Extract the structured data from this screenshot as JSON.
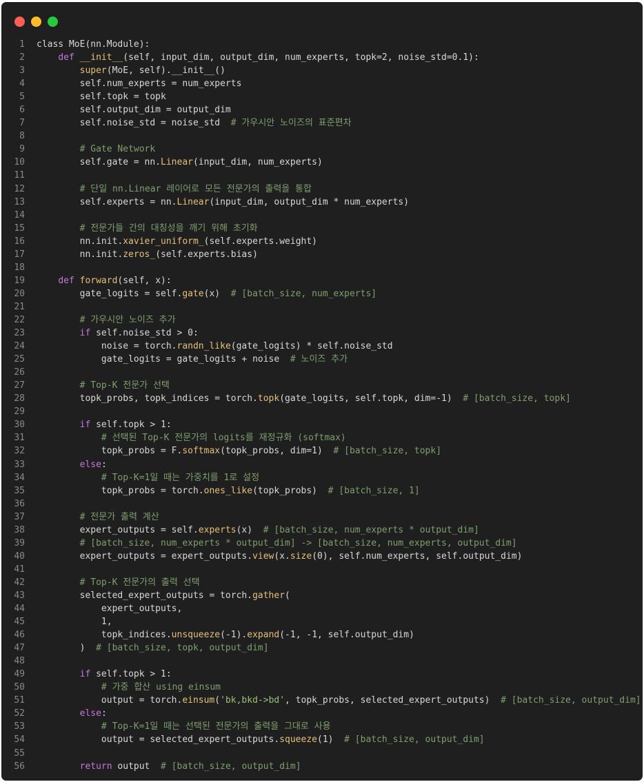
{
  "window": {
    "controls": [
      {
        "name": "close",
        "color": "#ff5f57"
      },
      {
        "name": "minimize",
        "color": "#febc2e"
      },
      {
        "name": "maximize",
        "color": "#28c840"
      }
    ]
  },
  "code_lines": [
    [
      {
        "t": "class MoE(nn.Module):",
        "c": ""
      }
    ],
    [
      {
        "t": "    ",
        "c": ""
      },
      {
        "t": "def",
        "c": "k"
      },
      {
        "t": " ",
        "c": ""
      },
      {
        "t": "__init__",
        "c": "f"
      },
      {
        "t": "(self, input_dim, output_dim, num_experts, topk=2, noise_std=0.1):",
        "c": ""
      }
    ],
    [
      {
        "t": "        ",
        "c": ""
      },
      {
        "t": "super",
        "c": "f"
      },
      {
        "t": "(MoE, self).__init__()",
        "c": ""
      }
    ],
    [
      {
        "t": "        self.num_experts = num_experts",
        "c": ""
      }
    ],
    [
      {
        "t": "        self.topk = topk",
        "c": ""
      }
    ],
    [
      {
        "t": "        self.output_dim = output_dim",
        "c": ""
      }
    ],
    [
      {
        "t": "        self.noise_std = noise_std  ",
        "c": ""
      },
      {
        "t": "# 가우시안 노이즈의 표준편차",
        "c": "c"
      }
    ],
    [],
    [
      {
        "t": "        ",
        "c": ""
      },
      {
        "t": "# Gate Network",
        "c": "c"
      }
    ],
    [
      {
        "t": "        self.gate = nn.",
        "c": ""
      },
      {
        "t": "Linear",
        "c": "f"
      },
      {
        "t": "(input_dim, num_experts)",
        "c": ""
      }
    ],
    [],
    [
      {
        "t": "        ",
        "c": ""
      },
      {
        "t": "# 단일 nn.Linear 레이어로 모든 전문가의 출력을 통합",
        "c": "c"
      }
    ],
    [
      {
        "t": "        self.experts = nn.",
        "c": ""
      },
      {
        "t": "Linear",
        "c": "f"
      },
      {
        "t": "(input_dim, output_dim * num_experts)",
        "c": ""
      }
    ],
    [],
    [
      {
        "t": "        ",
        "c": ""
      },
      {
        "t": "# 전문가들 간의 대칭성을 깨기 위해 초기화",
        "c": "c"
      }
    ],
    [
      {
        "t": "        nn.init.",
        "c": ""
      },
      {
        "t": "xavier_uniform_",
        "c": "f"
      },
      {
        "t": "(self.experts.weight)",
        "c": ""
      }
    ],
    [
      {
        "t": "        nn.init.",
        "c": ""
      },
      {
        "t": "zeros_",
        "c": "f"
      },
      {
        "t": "(self.experts.bias)",
        "c": ""
      }
    ],
    [],
    [
      {
        "t": "    ",
        "c": ""
      },
      {
        "t": "def",
        "c": "k"
      },
      {
        "t": " ",
        "c": ""
      },
      {
        "t": "forward",
        "c": "f"
      },
      {
        "t": "(self, x):",
        "c": ""
      }
    ],
    [
      {
        "t": "        gate_logits = self.",
        "c": ""
      },
      {
        "t": "gate",
        "c": "f"
      },
      {
        "t": "(x)  ",
        "c": ""
      },
      {
        "t": "# [batch_size, num_experts]",
        "c": "c"
      }
    ],
    [],
    [
      {
        "t": "        ",
        "c": ""
      },
      {
        "t": "# 가우시안 노이즈 추가",
        "c": "c"
      }
    ],
    [
      {
        "t": "        ",
        "c": ""
      },
      {
        "t": "if",
        "c": "k"
      },
      {
        "t": " self.noise_std > 0:",
        "c": ""
      }
    ],
    [
      {
        "t": "            noise = torch.",
        "c": ""
      },
      {
        "t": "randn_like",
        "c": "f"
      },
      {
        "t": "(gate_logits) * self.noise_std",
        "c": ""
      }
    ],
    [
      {
        "t": "            gate_logits = gate_logits + noise  ",
        "c": ""
      },
      {
        "t": "# 노이즈 추가",
        "c": "c"
      }
    ],
    [],
    [
      {
        "t": "        ",
        "c": ""
      },
      {
        "t": "# Top-K 전문가 선택",
        "c": "c"
      }
    ],
    [
      {
        "t": "        topk_probs, topk_indices = torch.",
        "c": ""
      },
      {
        "t": "topk",
        "c": "f"
      },
      {
        "t": "(gate_logits, self.topk, dim=-1)  ",
        "c": ""
      },
      {
        "t": "# [batch_size, topk]",
        "c": "c"
      }
    ],
    [],
    [
      {
        "t": "        ",
        "c": ""
      },
      {
        "t": "if",
        "c": "k"
      },
      {
        "t": " self.topk > 1:",
        "c": ""
      }
    ],
    [
      {
        "t": "            ",
        "c": ""
      },
      {
        "t": "# 선택된 Top-K 전문가의 logits를 재정규화 (softmax)",
        "c": "c"
      }
    ],
    [
      {
        "t": "            topk_probs = F.",
        "c": ""
      },
      {
        "t": "softmax",
        "c": "f"
      },
      {
        "t": "(topk_probs, dim=1)  ",
        "c": ""
      },
      {
        "t": "# [batch_size, topk]",
        "c": "c"
      }
    ],
    [
      {
        "t": "        ",
        "c": ""
      },
      {
        "t": "else",
        "c": "k"
      },
      {
        "t": ":",
        "c": ""
      }
    ],
    [
      {
        "t": "            ",
        "c": ""
      },
      {
        "t": "# Top-K=1일 때는 가중치를 1로 설정",
        "c": "c"
      }
    ],
    [
      {
        "t": "            topk_probs = torch.",
        "c": ""
      },
      {
        "t": "ones_like",
        "c": "f"
      },
      {
        "t": "(topk_probs)  ",
        "c": ""
      },
      {
        "t": "# [batch_size, 1]",
        "c": "c"
      }
    ],
    [],
    [
      {
        "t": "        ",
        "c": ""
      },
      {
        "t": "# 전문가 출력 계산",
        "c": "c"
      }
    ],
    [
      {
        "t": "        expert_outputs = self.",
        "c": ""
      },
      {
        "t": "experts",
        "c": "f"
      },
      {
        "t": "(x)  ",
        "c": ""
      },
      {
        "t": "# [batch_size, num_experts * output_dim]",
        "c": "c"
      }
    ],
    [
      {
        "t": "        ",
        "c": ""
      },
      {
        "t": "# [batch_size, num_experts * output_dim] -> [batch_size, num_experts, output_dim]",
        "c": "c"
      }
    ],
    [
      {
        "t": "        expert_outputs = expert_outputs.",
        "c": ""
      },
      {
        "t": "view",
        "c": "f"
      },
      {
        "t": "(x.",
        "c": ""
      },
      {
        "t": "size",
        "c": "f"
      },
      {
        "t": "(0), self.num_experts, self.output_dim)",
        "c": ""
      }
    ],
    [],
    [
      {
        "t": "        ",
        "c": ""
      },
      {
        "t": "# Top-K 전문가의 출력 선택",
        "c": "c"
      }
    ],
    [
      {
        "t": "        selected_expert_outputs = torch.",
        "c": ""
      },
      {
        "t": "gather",
        "c": "f"
      },
      {
        "t": "(",
        "c": ""
      }
    ],
    [
      {
        "t": "            expert_outputs,",
        "c": ""
      }
    ],
    [
      {
        "t": "            1,",
        "c": ""
      }
    ],
    [
      {
        "t": "            topk_indices.",
        "c": ""
      },
      {
        "t": "unsqueeze",
        "c": "f"
      },
      {
        "t": "(-1).",
        "c": ""
      },
      {
        "t": "expand",
        "c": "f"
      },
      {
        "t": "(-1, -1, self.output_dim)",
        "c": ""
      }
    ],
    [
      {
        "t": "        )  ",
        "c": ""
      },
      {
        "t": "# [batch_size, topk, output_dim]",
        "c": "c"
      }
    ],
    [],
    [
      {
        "t": "        ",
        "c": ""
      },
      {
        "t": "if",
        "c": "k"
      },
      {
        "t": " self.topk > 1:",
        "c": ""
      }
    ],
    [
      {
        "t": "            ",
        "c": ""
      },
      {
        "t": "# 가중 합산 using einsum",
        "c": "c"
      }
    ],
    [
      {
        "t": "            output = torch.",
        "c": ""
      },
      {
        "t": "einsum",
        "c": "f"
      },
      {
        "t": "(",
        "c": ""
      },
      {
        "t": "'bk,bkd->bd'",
        "c": "s"
      },
      {
        "t": ", topk_probs, selected_expert_outputs)  ",
        "c": ""
      },
      {
        "t": "# [batch_size, output_dim]",
        "c": "c"
      }
    ],
    [
      {
        "t": "        ",
        "c": ""
      },
      {
        "t": "else",
        "c": "k"
      },
      {
        "t": ":",
        "c": ""
      }
    ],
    [
      {
        "t": "            ",
        "c": ""
      },
      {
        "t": "# Top-K=1일 때는 선택된 전문가의 출력을 그대로 사용",
        "c": "c"
      }
    ],
    [
      {
        "t": "            output = selected_expert_outputs.",
        "c": ""
      },
      {
        "t": "squeeze",
        "c": "f"
      },
      {
        "t": "(1)  ",
        "c": ""
      },
      {
        "t": "# [batch_size, output_dim]",
        "c": "c"
      }
    ],
    [],
    [
      {
        "t": "        ",
        "c": ""
      },
      {
        "t": "return",
        "c": "k"
      },
      {
        "t": " output  ",
        "c": ""
      },
      {
        "t": "# [batch_size, output_dim]",
        "c": "c"
      }
    ]
  ]
}
